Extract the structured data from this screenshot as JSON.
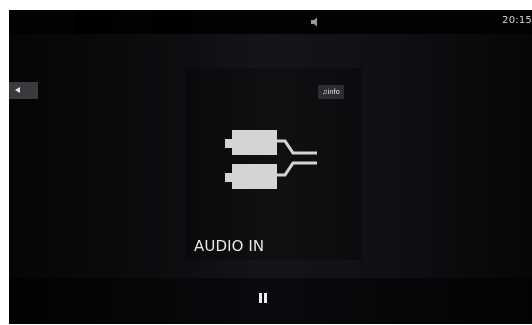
{
  "status_bar": {
    "clock": "20:15",
    "icons": [
      "circle-icon",
      "speaker-icon"
    ]
  },
  "navigation": {
    "back_icon": "back-arrow-icon"
  },
  "source_card": {
    "info_label": "♫info",
    "source_icon": "cable-icon",
    "source_label": "AUDIO IN"
  },
  "controls": {
    "pause_icon": "pause-icon"
  },
  "colors": {
    "background": "#0d0d10",
    "card": "#101013",
    "button": "#3a3a3e",
    "text": "#e8e8e8"
  }
}
